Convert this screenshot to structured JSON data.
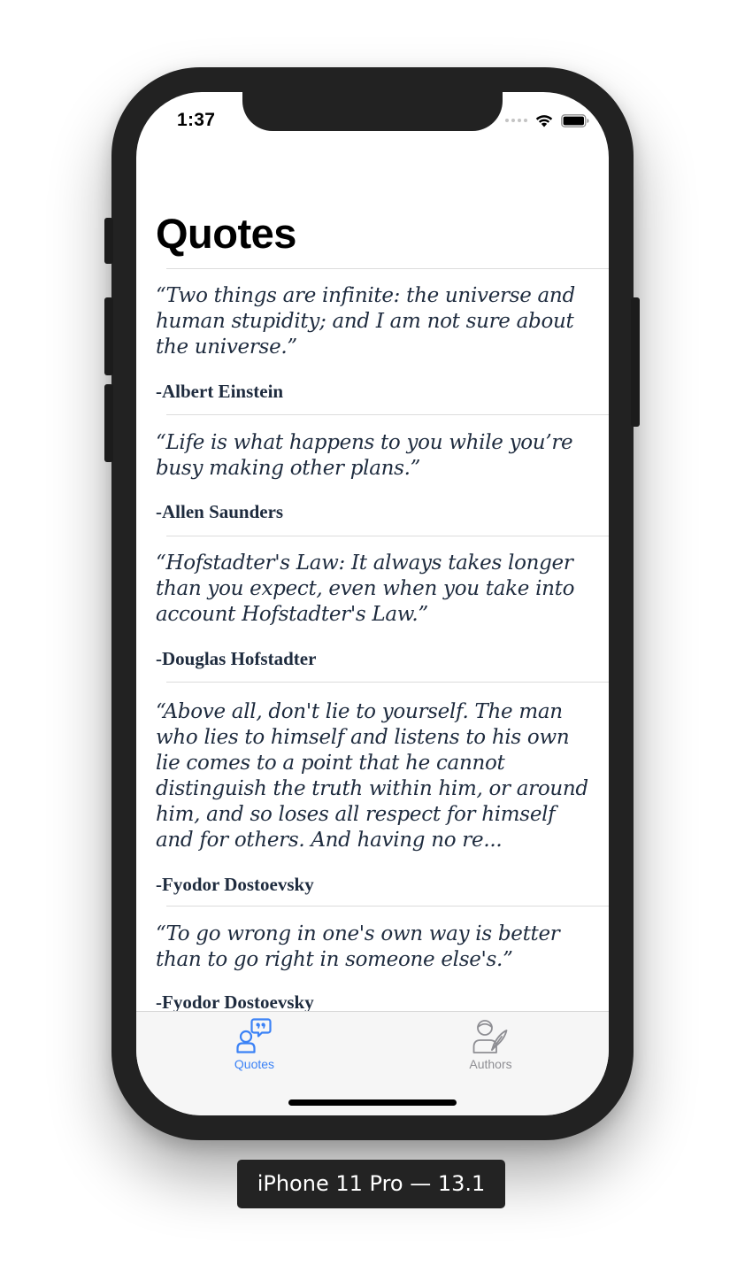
{
  "status_bar": {
    "time": "1:37"
  },
  "nav": {
    "title": "Quotes"
  },
  "quotes": [
    {
      "text": "“Two things are infinite: the universe and human stupidity; and I am not sure about the universe.”",
      "author": "-Albert Einstein"
    },
    {
      "text": "“Life is what happens to you while you’re busy making other plans.”",
      "author": "-Allen Saunders"
    },
    {
      "text": "“Hofstadter's Law: It always takes longer than you expect, even when you take into account Hofstadter's Law.”",
      "author": "-Douglas Hofstadter"
    },
    {
      "text": "“Above all, don't lie to yourself. The man who lies to himself and listens to his own lie comes to a point that he cannot distinguish the truth within him, or around him, and so loses all respect for himself and for others. And having no re...",
      "author": "-Fyodor Dostoevsky"
    },
    {
      "text": "“To go wrong in one's own way is better than to go right in someone else's.”",
      "author": "-Fyodor Dostoevsky"
    }
  ],
  "tabs": [
    {
      "label": "Quotes",
      "icon": "quotes-person-icon",
      "selected": true
    },
    {
      "label": "Authors",
      "icon": "author-quill-icon",
      "selected": false
    }
  ],
  "simulator": {
    "device_label": "iPhone 11 Pro — 13.1"
  },
  "colors": {
    "accent": "#3b82f6",
    "text": "#1e2b3e",
    "tab_inactive": "#8e8e93"
  }
}
